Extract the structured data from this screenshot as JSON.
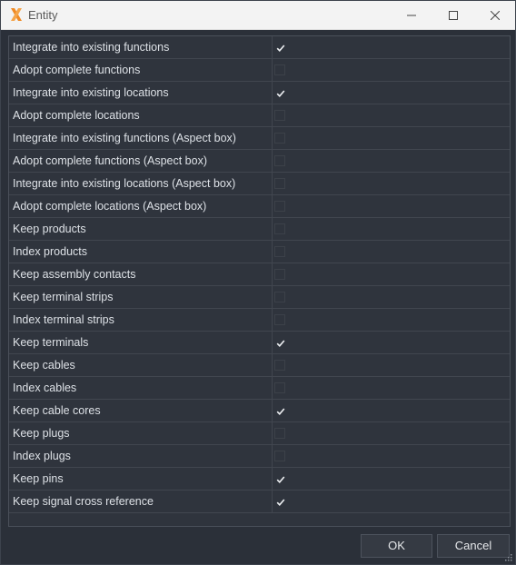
{
  "window": {
    "title": "Entity",
    "icon": "x-logo-icon",
    "accent": "#f08a24"
  },
  "rows": [
    {
      "label": "Integrate into existing functions",
      "checked": true
    },
    {
      "label": "Adopt complete functions",
      "checked": false
    },
    {
      "label": "Integrate into existing locations",
      "checked": true
    },
    {
      "label": "Adopt complete locations",
      "checked": false
    },
    {
      "label": "Integrate into existing functions (Aspect box)",
      "checked": false
    },
    {
      "label": "Adopt complete functions (Aspect box)",
      "checked": false
    },
    {
      "label": "Integrate into existing locations (Aspect box)",
      "checked": false
    },
    {
      "label": "Adopt complete locations (Aspect box)",
      "checked": false
    },
    {
      "label": "Keep products",
      "checked": false
    },
    {
      "label": "Index products",
      "checked": false
    },
    {
      "label": "Keep assembly contacts",
      "checked": false
    },
    {
      "label": "Keep terminal strips",
      "checked": false
    },
    {
      "label": "Index terminal strips",
      "checked": false
    },
    {
      "label": "Keep terminals",
      "checked": true
    },
    {
      "label": "Keep cables",
      "checked": false
    },
    {
      "label": "Index cables",
      "checked": false
    },
    {
      "label": "Keep cable cores",
      "checked": true
    },
    {
      "label": "Keep plugs",
      "checked": false
    },
    {
      "label": "Index plugs",
      "checked": false
    },
    {
      "label": "Keep pins",
      "checked": true
    },
    {
      "label": "Keep signal cross reference",
      "checked": true
    }
  ],
  "buttons": {
    "ok_label": "OK",
    "cancel_label": "Cancel"
  }
}
